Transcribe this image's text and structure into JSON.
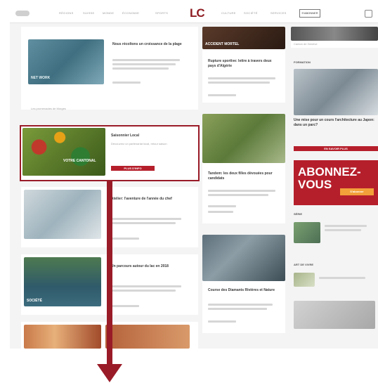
{
  "header": {
    "logo": "LC",
    "nav_left": [
      "RÉGIONS",
      "SUISSE",
      "MONDE",
      "ÉCONOMIE",
      "SPORTS"
    ],
    "nav_right": [
      "CULTURE",
      "SOCIÉTÉ",
      "SERVICES"
    ],
    "subscribe_label": "S'ABONNER"
  },
  "left_column": {
    "article1_title": "Nous récoltons un croissance de la plage",
    "article1_thumb_tag": "NET WORK",
    "article1_footer": "Les promenades de Morges",
    "featured": {
      "title": "Saisonnier Local",
      "text": "Découvrez un partenariat local, retour saison",
      "cta": "PLUS D'INFO",
      "thumb_text": "VOTRE CANTONAL"
    },
    "article3_title": "Atelier: l'aventure de l'année du chef",
    "article4_title": "Un parcours autour du lac en 2018",
    "article4_thumb_tag": "SOCIÉTÉ"
  },
  "mid_column": {
    "top_tag": "ACCIDENT MORTEL",
    "article1_title": "Rupture sportive: lettre à travers deux pays d'Algérie",
    "article2_title": "Tandem: les deux filles dévouées pour candidats",
    "article3_title": "Course des Diamants Rivières et Nature"
  },
  "right_column": {
    "top_caption": "Canton de Genève",
    "section1": "FORMATION",
    "section1_text": "Une mise pour un cours l'architecture au Japon: dans un parc?",
    "section1_cta": "EN SAVOIR PLUS",
    "subscribe_banner": "ABONNEZ-VOUS",
    "subscribe_cta": "S'abonner",
    "section2": "SÉRIE",
    "section3": "ART DE VIVRE"
  },
  "colors": {
    "accent": "#9a1b28",
    "cta": "#b51f2b",
    "background": "#f4f4f4"
  }
}
